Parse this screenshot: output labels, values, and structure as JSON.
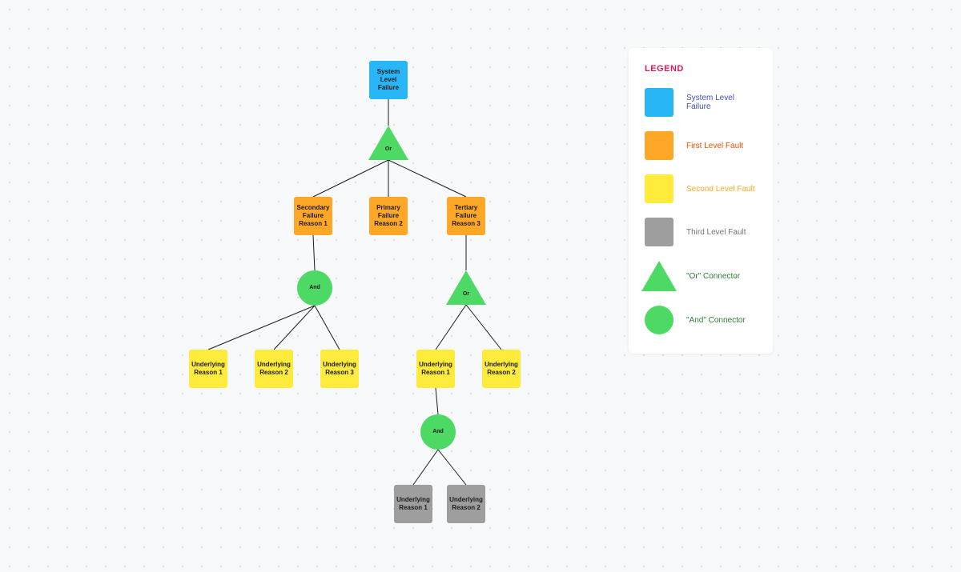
{
  "legend": {
    "title": "LEGEND",
    "items": [
      {
        "label": "System Level Failure"
      },
      {
        "label": "First Level Fault"
      },
      {
        "label": "Second Level Fault"
      },
      {
        "label": "Third Level Fault"
      },
      {
        "label": "\"Or\" Connector"
      },
      {
        "label": "\"And\" Connector"
      }
    ]
  },
  "connectors": {
    "or_label": "Or",
    "and_label": "And"
  },
  "nodes": {
    "root": "System Level Failure",
    "level1": [
      "Secondary Failure Reason 1",
      "Primary Failure Reason 2",
      "Tertiary Failure Reason 3"
    ],
    "level2_left": [
      "Underlying Reason 1",
      "Underlying Reason 2",
      "Underlying Reason 3"
    ],
    "level2_right": [
      "Underlying Reason 1",
      "Underlying Reason 2"
    ],
    "level3": [
      "Underlying Reason 1",
      "Underlying Reason 2"
    ]
  },
  "colors": {
    "blue": "#29b6f6",
    "orange": "#ffa726",
    "yellow": "#ffeb3b",
    "grey": "#9e9e9e",
    "green": "#4cd964"
  }
}
